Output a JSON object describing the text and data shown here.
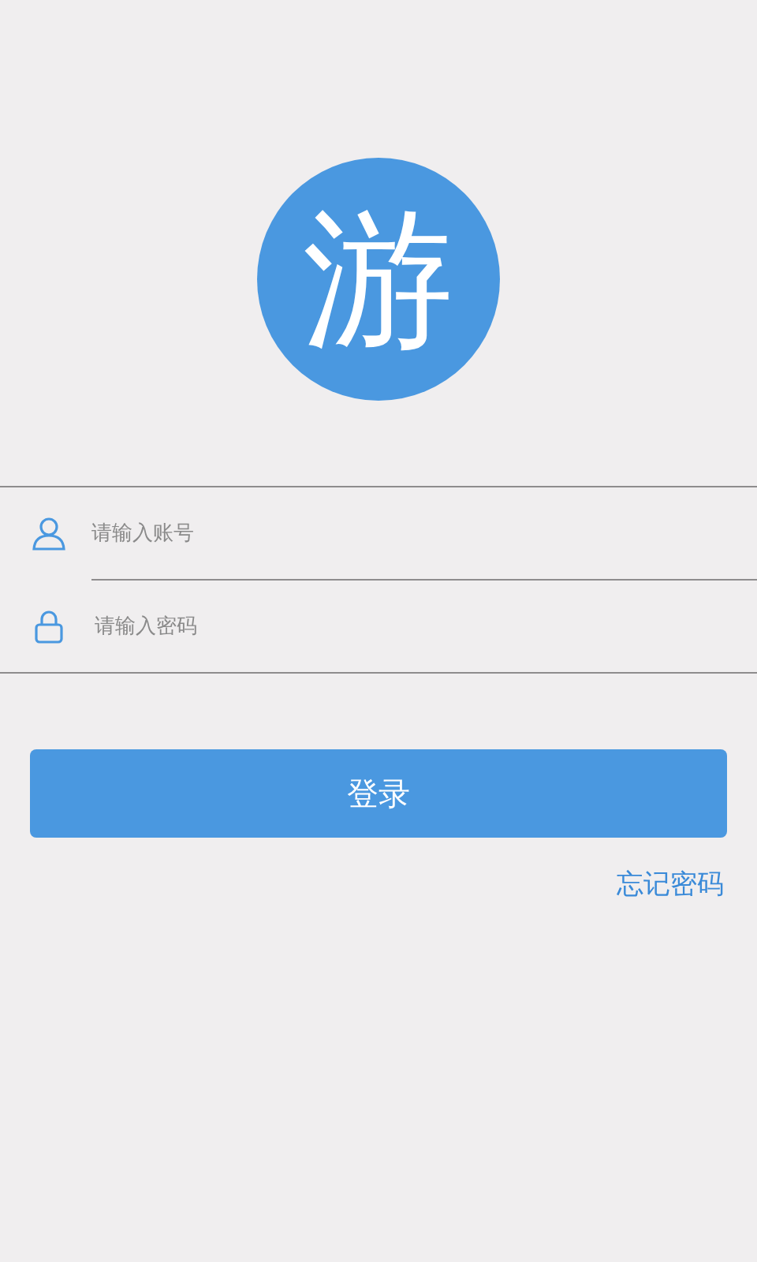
{
  "logo": {
    "text": "游"
  },
  "fields": [
    {
      "kind": "user",
      "placeholder": "请输入账号"
    },
    {
      "kind": "lock",
      "placeholder": "请输入密码"
    }
  ],
  "login_button": {
    "label": "登录"
  },
  "forgot_link": {
    "label": "忘记密码"
  }
}
